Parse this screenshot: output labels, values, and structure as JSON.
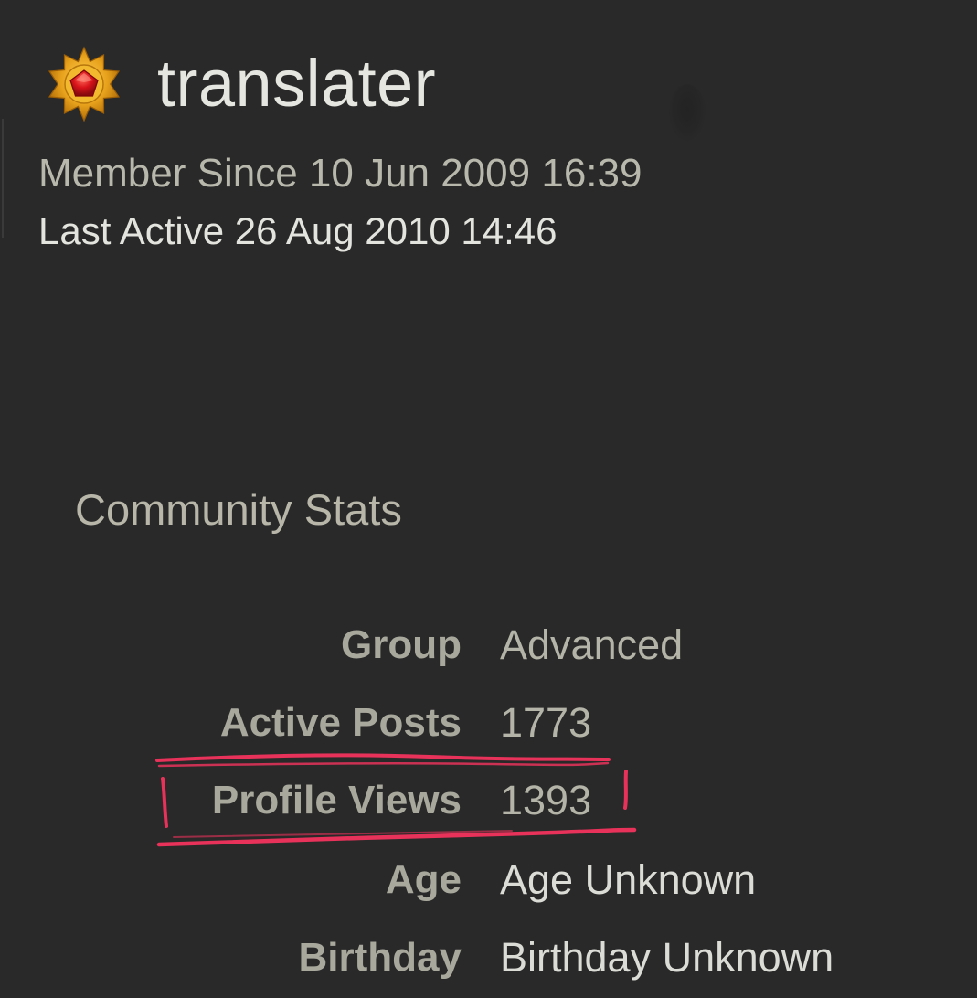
{
  "profile": {
    "username": "translater",
    "rank_icon": "star-badge-icon",
    "member_since_label": "Member Since",
    "member_since_value": "10 Jun 2009 16:39",
    "last_active_label": "Last Active",
    "last_active_value": "26 Aug 2010 14:46"
  },
  "community_stats": {
    "title": "Community Stats",
    "rows": [
      {
        "label": "Group",
        "value": "Advanced"
      },
      {
        "label": "Active Posts",
        "value": "1773"
      },
      {
        "label": "Profile Views",
        "value": "1393"
      },
      {
        "label": "Age",
        "value": "Age Unknown"
      },
      {
        "label": "Birthday",
        "value": "Birthday Unknown"
      }
    ]
  },
  "colors": {
    "background": "#292929",
    "annotation": "#e8325a",
    "badge_gold": "#e8a21c",
    "badge_red": "#d8141a"
  }
}
